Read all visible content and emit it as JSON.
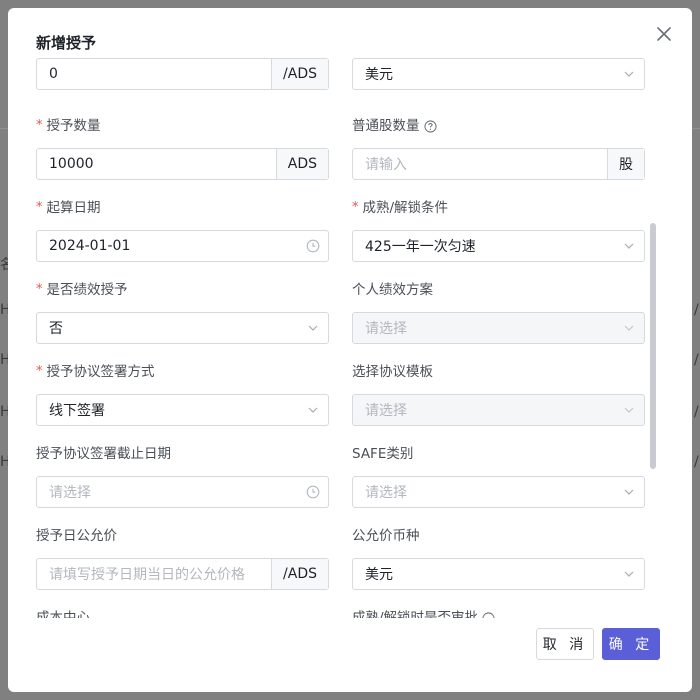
{
  "modal": {
    "title": "新增授予",
    "cancel_label": "取 消",
    "confirm_label": "确 定"
  },
  "colors": {
    "primary": "#5b5fd7",
    "required": "#e2574c"
  },
  "backdrop": {
    "fragments": [
      "名",
      "H",
      "H",
      "H",
      "H",
      "/",
      "/",
      "/",
      "/"
    ]
  },
  "fields": {
    "price": {
      "value": "0",
      "suffix": "/ADS"
    },
    "price_currency": {
      "value": "美元"
    },
    "grant_quantity": {
      "label": "授予数量",
      "value": "10000",
      "suffix": "ADS"
    },
    "common_shares": {
      "label": "普通股数量",
      "placeholder": "请输入",
      "suffix": "股"
    },
    "start_date": {
      "label": "起算日期",
      "value": "2024-01-01"
    },
    "vesting_condition": {
      "label": "成熟/解锁条件",
      "value": "425一年一次匀速"
    },
    "is_performance": {
      "label": "是否绩效授予",
      "value": "否"
    },
    "performance_plan": {
      "label": "个人绩效方案",
      "placeholder": "请选择"
    },
    "sign_method": {
      "label": "授予协议签署方式",
      "value": "线下签署"
    },
    "agreement_template": {
      "label": "选择协议模板",
      "placeholder": "请选择"
    },
    "sign_deadline": {
      "label": "授予协议签署截止日期",
      "placeholder": "请选择"
    },
    "safe_type": {
      "label": "SAFE类别",
      "placeholder": "请选择"
    },
    "fair_value": {
      "label": "授予日公允价",
      "placeholder": "请填写授予日期当日的公允价格",
      "suffix": "/ADS"
    },
    "fair_value_currency": {
      "label": "公允价币种",
      "value": "美元"
    },
    "cost_center": {
      "label": "成本中心"
    },
    "vesting_approval": {
      "label": "成熟/解锁时是否审批"
    }
  }
}
